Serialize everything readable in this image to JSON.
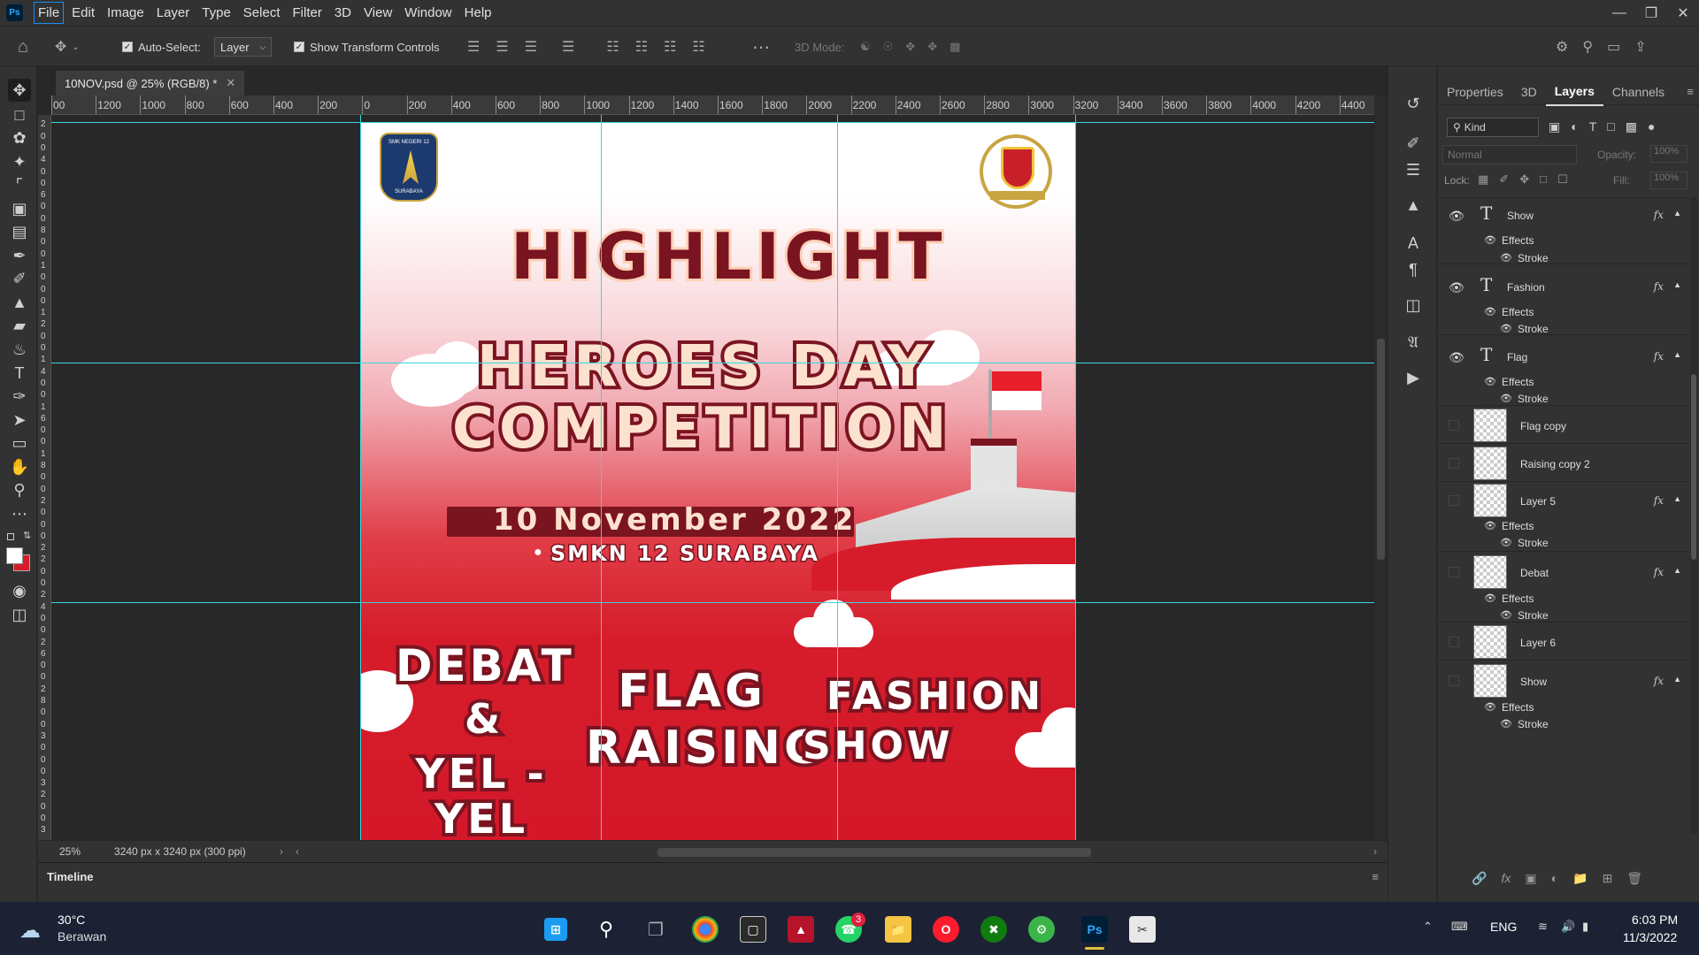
{
  "menubar": {
    "app_logo": "Ps",
    "items": [
      "File",
      "Edit",
      "Image",
      "Layer",
      "Type",
      "Select",
      "Filter",
      "3D",
      "View",
      "Window",
      "Help"
    ]
  },
  "options_bar": {
    "auto_select_label": "Auto-Select:",
    "auto_select_value": "Layer",
    "transform_controls_label": "Show Transform Controls",
    "mode_3d_label": "3D Mode:"
  },
  "document": {
    "tab_title": "10NOV.psd @ 25% (RGB/8) *",
    "zoom": "25%",
    "doc_info": "3240 px x 3240 px (300 ppi)"
  },
  "ruler_top": [
    "00",
    "1200",
    "1000",
    "800",
    "600",
    "400",
    "200",
    "0",
    "200",
    "400",
    "600",
    "800",
    "1000",
    "1200",
    "1400",
    "1600",
    "1800",
    "2000",
    "2200",
    "2400",
    "2600",
    "2800",
    "3000",
    "3200",
    "3400",
    "3600",
    "3800",
    "4000",
    "4200",
    "4400"
  ],
  "ruler_left": [
    "0",
    "2",
    "0",
    "0",
    "4",
    "0",
    "0",
    "6",
    "0",
    "0",
    "8",
    "0",
    "0",
    "1",
    "0",
    "0",
    "0",
    "1",
    "2",
    "0",
    "0",
    "1",
    "4",
    "0",
    "0",
    "1",
    "6",
    "0",
    "0",
    "1",
    "8",
    "0",
    "0",
    "2",
    "0",
    "0",
    "0",
    "2",
    "2",
    "0",
    "0",
    "2",
    "4",
    "0",
    "0",
    "2",
    "6",
    "0",
    "0",
    "2",
    "8",
    "0",
    "0",
    "3",
    "0",
    "0",
    "0",
    "3",
    "2",
    "0",
    "0",
    "3"
  ],
  "artwork": {
    "title": "HIGHLIGHT",
    "line1": "HEROES DAY",
    "line2": "COMPETITION",
    "date": "10 November 2022",
    "location": "SMKN 12 SURABAYA",
    "logo_left_text": "SMK NEGERI 12",
    "logo_left_sub": "SURABAYA",
    "event1_a": "DEBAT",
    "event1_b": "&",
    "event1_c": "YEL - YEL",
    "event2_a": "FLAG",
    "event2_b": "RAISING",
    "event3_a": "FASHION",
    "event3_b": "SHOW"
  },
  "panel": {
    "tabs": [
      "Properties",
      "3D",
      "Layers",
      "Channels"
    ],
    "active_tab": "Layers",
    "filter_kind": "Kind",
    "blend_mode": "Normal",
    "opacity_label": "Opacity:",
    "opacity_value": "100%",
    "lock_label": "Lock:",
    "fill_label": "Fill:",
    "fill_value": "100%",
    "layers": [
      {
        "name": "Show",
        "type": "text",
        "visible": true,
        "fx": true,
        "effects": [
          "Effects",
          "Stroke"
        ]
      },
      {
        "name": "Fashion",
        "type": "text",
        "visible": true,
        "fx": true,
        "effects": [
          "Effects",
          "Stroke"
        ]
      },
      {
        "name": "Flag",
        "type": "text",
        "visible": true,
        "fx": true,
        "effects": [
          "Effects",
          "Stroke"
        ]
      },
      {
        "name": "Flag copy",
        "type": "raster",
        "visible": false,
        "fx": false
      },
      {
        "name": "Raising copy 2",
        "type": "raster",
        "visible": false,
        "fx": false
      },
      {
        "name": "Layer 5",
        "type": "raster",
        "visible": false,
        "fx": true,
        "effects": [
          "Effects",
          "Stroke"
        ]
      },
      {
        "name": "Debat",
        "type": "raster",
        "visible": false,
        "fx": true,
        "effects": [
          "Effects",
          "Stroke"
        ]
      },
      {
        "name": "Layer 6",
        "type": "raster",
        "visible": false,
        "fx": false
      },
      {
        "name": "Show",
        "type": "raster",
        "visible": false,
        "fx": true,
        "effects": [
          "Effects",
          "Stroke"
        ]
      }
    ]
  },
  "timeline": {
    "label": "Timeline"
  },
  "taskbar": {
    "weather_temp": "30°C",
    "weather_desc": "Berawan",
    "language": "ENG",
    "time": "6:03 PM",
    "date": "11/3/2022",
    "whatsapp_badge": "3",
    "ps_label": "Ps"
  },
  "colors": {
    "accent": "#1a8ef0",
    "guide": "#3ad7e0",
    "dark_red": "#7a1420",
    "red": "#d61c2a"
  }
}
